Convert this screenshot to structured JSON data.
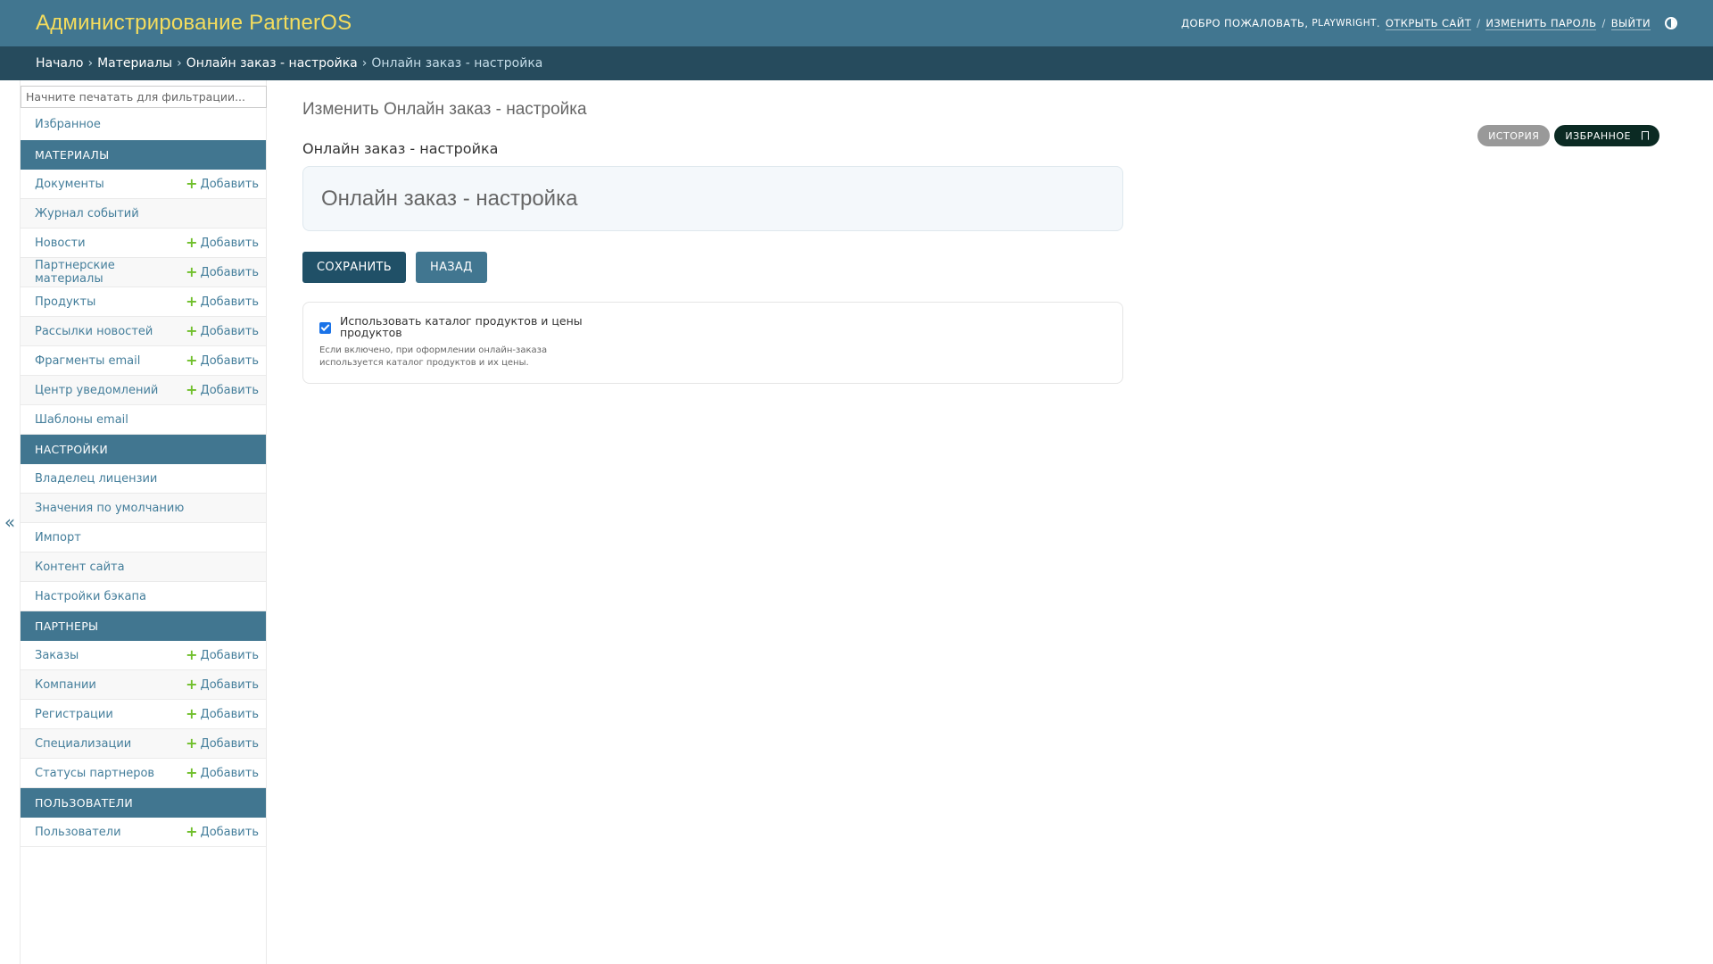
{
  "header": {
    "branding": "Администрирование PartnerOS",
    "welcome": "Добро пожаловать,",
    "username": "playwright",
    "view_site": "Открыть сайт",
    "change_password": "Изменить пароль",
    "logout": "Выйти",
    "theme_toggle_icon": "half-circle-icon"
  },
  "breadcrumbs": {
    "home": "Начало",
    "app": "Материалы",
    "model": "Онлайн заказ - настройка",
    "current": "Онлайн заказ - настройка"
  },
  "sidebar": {
    "filter_placeholder": "Начните печатать для фильтрации...",
    "collapse_label": "«",
    "favorites": "Избранное",
    "add_label": "Добавить",
    "sections": [
      {
        "title": "Материалы",
        "items": [
          {
            "label": "Документы",
            "add": true
          },
          {
            "label": "Журнал событий",
            "add": false
          },
          {
            "label": "Новости",
            "add": true
          },
          {
            "label": "Партнерские материалы",
            "add": true
          },
          {
            "label": "Продукты",
            "add": true
          },
          {
            "label": "Рассылки новостей",
            "add": true
          },
          {
            "label": "Фрагменты email",
            "add": true
          },
          {
            "label": "Центр уведомлений",
            "add": true
          },
          {
            "label": "Шаблоны email",
            "add": false
          }
        ]
      },
      {
        "title": "Настройки",
        "items": [
          {
            "label": "Владелец лицензии",
            "add": false
          },
          {
            "label": "Значения по умолчанию",
            "add": false
          },
          {
            "label": "Импорт",
            "add": false
          },
          {
            "label": "Контент сайта",
            "add": false
          },
          {
            "label": "Настройки бэкапа",
            "add": false
          }
        ]
      },
      {
        "title": "Партнеры",
        "items": [
          {
            "label": "Заказы",
            "add": true
          },
          {
            "label": "Компании",
            "add": true
          },
          {
            "label": "Регистрации",
            "add": true
          },
          {
            "label": "Специализации",
            "add": true
          },
          {
            "label": "Статусы партнеров",
            "add": true
          }
        ]
      },
      {
        "title": "Пользователи",
        "items": [
          {
            "label": "Пользователи",
            "add": true
          }
        ]
      }
    ]
  },
  "main": {
    "page_title": "Изменить Онлайн заказ - настройка",
    "object_subtitle": "Онлайн заказ - настройка",
    "object_tools": {
      "history": "История",
      "favorite": "Избранное"
    },
    "title_box": "Онлайн заказ - настройка",
    "buttons": {
      "save": "Сохранить",
      "back": "Назад"
    },
    "settings": {
      "use_catalog_label": "Использовать каталог продуктов и цены продуктов",
      "use_catalog_checked": true,
      "use_catalog_help": "Если включено, при оформлении онлайн-заказа используется каталог продуктов и их цены."
    }
  },
  "colors": {
    "header_bg": "#417690",
    "breadcrumbs_bg": "#264b5d",
    "branding": "#f5dd5d",
    "link": "#447e9b",
    "add_plus": "#70bf2b",
    "save_button": "#205067",
    "favorite_button": "#0b2a23"
  }
}
